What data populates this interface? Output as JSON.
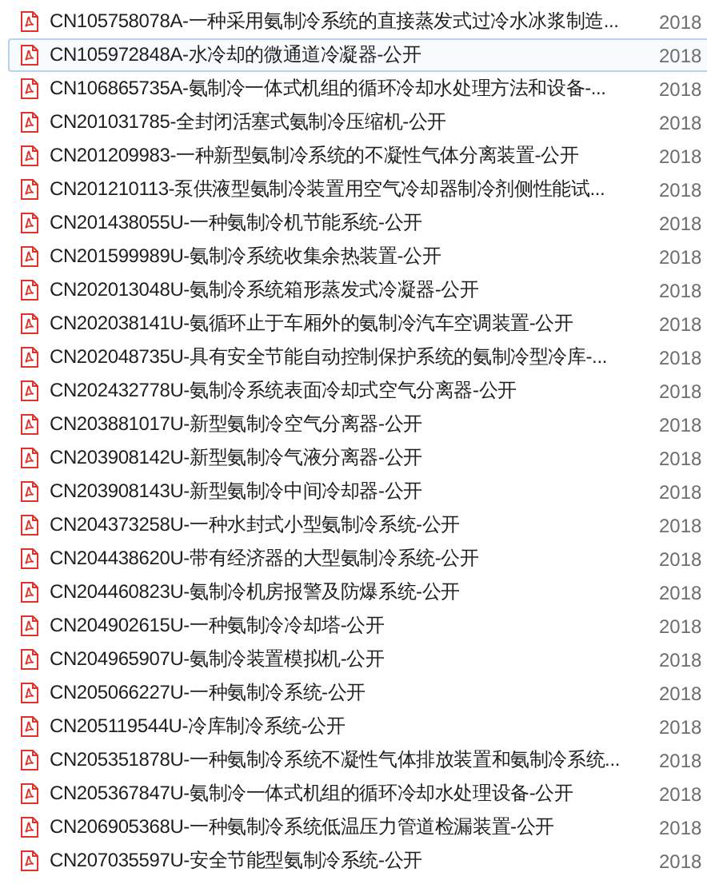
{
  "files": [
    {
      "name": "CN105758078A-一种采用氨制冷系统的直接蒸发式过冷水冰浆制造...",
      "date": "2018",
      "selected": false
    },
    {
      "name": "CN105972848A-水冷却的微通道冷凝器-公开",
      "date": "2018",
      "selected": true
    },
    {
      "name": "CN106865735A-氨制冷一体式机组的循环冷却水处理方法和设备-...",
      "date": "2018",
      "selected": false
    },
    {
      "name": "CN201031785-全封闭活塞式氨制冷压缩机-公开",
      "date": "2018",
      "selected": false
    },
    {
      "name": "CN201209983-一种新型氨制冷系统的不凝性气体分离装置-公开",
      "date": "2018",
      "selected": false
    },
    {
      "name": "CN201210113-泵供液型氨制冷装置用空气冷却器制冷剂侧性能试...",
      "date": "2018",
      "selected": false
    },
    {
      "name": "CN201438055U-一种氨制冷机节能系统-公开",
      "date": "2018",
      "selected": false
    },
    {
      "name": "CN201599989U-氨制冷系统收集余热装置-公开",
      "date": "2018",
      "selected": false
    },
    {
      "name": "CN202013048U-氨制冷系统箱形蒸发式冷凝器-公开",
      "date": "2018",
      "selected": false
    },
    {
      "name": "CN202038141U-氨循环止于车厢外的氨制冷汽车空调装置-公开",
      "date": "2018",
      "selected": false
    },
    {
      "name": "CN202048735U-具有安全节能自动控制保护系统的氨制冷型冷库-...",
      "date": "2018",
      "selected": false
    },
    {
      "name": "CN202432778U-氨制冷系统表面冷却式空气分离器-公开",
      "date": "2018",
      "selected": false
    },
    {
      "name": "CN203881017U-新型氨制冷空气分离器-公开",
      "date": "2018",
      "selected": false
    },
    {
      "name": "CN203908142U-新型氨制冷气液分离器-公开",
      "date": "2018",
      "selected": false
    },
    {
      "name": "CN203908143U-新型氨制冷中间冷却器-公开",
      "date": "2018",
      "selected": false
    },
    {
      "name": "CN204373258U-一种水封式小型氨制冷系统-公开",
      "date": "2018",
      "selected": false
    },
    {
      "name": "CN204438620U-带有经济器的大型氨制冷系统-公开",
      "date": "2018",
      "selected": false
    },
    {
      "name": "CN204460823U-氨制冷机房报警及防爆系统-公开",
      "date": "2018",
      "selected": false
    },
    {
      "name": "CN204902615U-一种氨制冷冷却塔-公开",
      "date": "2018",
      "selected": false
    },
    {
      "name": "CN204965907U-氨制冷装置模拟机-公开",
      "date": "2018",
      "selected": false
    },
    {
      "name": "CN205066227U-一种氨制冷系统-公开",
      "date": "2018",
      "selected": false
    },
    {
      "name": "CN205119544U-冷库制冷系统-公开",
      "date": "2018",
      "selected": false
    },
    {
      "name": "CN205351878U-一种氨制冷系统不凝性气体排放装置和氨制冷系统...",
      "date": "2018",
      "selected": false
    },
    {
      "name": "CN205367847U-氨制冷一体式机组的循环冷却水处理设备-公开",
      "date": "2018",
      "selected": false
    },
    {
      "name": "CN206905368U-一种氨制冷系统低温压力管道检漏装置-公开",
      "date": "2018",
      "selected": false
    },
    {
      "name": "CN207035597U-安全节能型氨制冷系统-公开",
      "date": "2018",
      "selected": false
    }
  ]
}
